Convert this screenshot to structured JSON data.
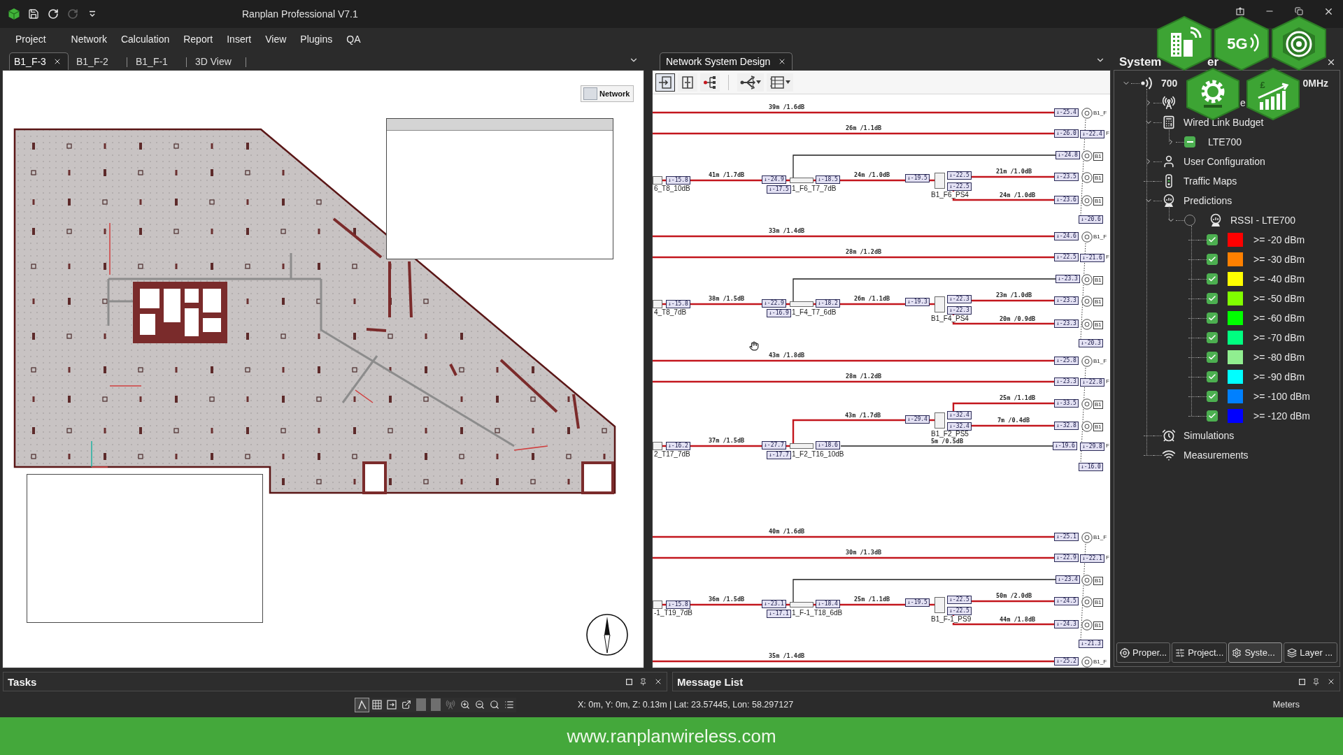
{
  "title_bar": {
    "quick_access": [
      {
        "kind": "save",
        "disabled": false
      },
      {
        "kind": "undo",
        "disabled": false
      },
      {
        "kind": "redo",
        "disabled": true
      },
      {
        "kind": "customize",
        "disabled": false
      }
    ],
    "title": "Ranplan Professional V7.1"
  },
  "overlay_badges": [
    {
      "kind": "building"
    },
    {
      "kind": "cellular",
      "label": "5G"
    },
    {
      "kind": "rings"
    },
    {
      "kind": "gear"
    },
    {
      "kind": "chart",
      "label": "£"
    }
  ],
  "menu": [
    {
      "label": "Project"
    },
    {
      "label": "Network"
    },
    {
      "label": "Calculation"
    },
    {
      "label": "Report"
    },
    {
      "label": "Insert"
    },
    {
      "label": "View"
    },
    {
      "label": "Plugins"
    },
    {
      "label": "QA"
    }
  ],
  "floor_tabs": [
    {
      "label": "B1_F-3",
      "selected": true
    },
    {
      "label": "B1_F-2",
      "selected": false
    },
    {
      "label": "B1_F-1",
      "selected": false
    },
    {
      "label": "3D View",
      "selected": false
    }
  ],
  "floor_plan": {
    "layer_button": "Network"
  },
  "design_tab": {
    "label": "Network System Design",
    "selected": true
  },
  "design_toolbar": [
    {
      "kind": "frame-arrow",
      "selected": true,
      "dropdown": false
    },
    {
      "kind": "frame-split",
      "selected": false,
      "dropdown": false
    },
    {
      "kind": "node-tree",
      "selected": false,
      "dropdown": false
    },
    {
      "kind": "branch-arrows",
      "selected": false,
      "dropdown": true
    },
    {
      "kind": "table-grid",
      "selected": false,
      "dropdown": true
    }
  ],
  "diagram": {
    "groups": [
      {
        "kind": "splitter_below",
        "feeders": [
          {
            "cable": "39m /1.6dB",
            "end_tag": "↓-25.4",
            "antenna": "B1_F"
          },
          {
            "cable": "26m /1.1dB",
            "end_tag": "↓-26.0",
            "antenna_tag": "↓-22.4",
            "antenna": "F"
          }
        ],
        "source": {
          "name": "6_T8_10dB",
          "tag": "↓-15.8"
        },
        "cable_in": "41m /1.7dB",
        "tap": {
          "name": "1_F6_T7_7dB",
          "in_tag": "↓-24.9",
          "out_tag": "↓-17.5",
          "through_tag": "↓-18.5"
        },
        "tap_branch": {
          "end_tag": "↓-24.8",
          "antenna": "B1"
        },
        "cable_mid": "24m /1.0dB",
        "splitter": {
          "name": "B1_F6_PS4",
          "in_tag": "↓-19.5",
          "out_tags": [
            "↓-22.5",
            "↓-22.5"
          ]
        },
        "branches": [
          {
            "cable": "21m /1.0dB",
            "end_tag": "↓-23.5",
            "antenna": "B1"
          },
          {
            "cable": "24m /1.0dB",
            "end_tag": "↓-23.6",
            "antenna": "B1"
          }
        ],
        "bottom_tag": "↓-20.6"
      },
      {
        "kind": "splitter_below",
        "feeders": [
          {
            "cable": "33m /1.4dB",
            "end_tag": "↓-24.6",
            "antenna": "B1_F"
          },
          {
            "cable": "28m /1.2dB",
            "end_tag": "↓-22.5",
            "antenna_tag": "↓-21.6",
            "antenna": "F"
          }
        ],
        "source": {
          "name": "4_T8_7dB",
          "tag": "↓-15.8"
        },
        "cable_in": "38m /1.5dB",
        "tap": {
          "name": "1_F4_T7_6dB",
          "in_tag": "↓-22.9",
          "out_tag": "↓-16.9",
          "through_tag": "↓-18.2"
        },
        "tap_branch": {
          "end_tag": "↓-23.3",
          "antenna": "B1"
        },
        "cable_mid": "26m /1.1dB",
        "splitter": {
          "name": "B1_F4_PS4",
          "in_tag": "↓-19.3",
          "out_tags": [
            "↓-22.3",
            "↓-22.3"
          ]
        },
        "branches": [
          {
            "cable": "23m /1.0dB",
            "end_tag": "↓-23.3",
            "antenna": "B1"
          },
          {
            "cable": "20m /0.9dB",
            "end_tag": "↓-23.3",
            "antenna": "B1"
          }
        ],
        "bottom_tag": "↓-20.3"
      },
      {
        "kind": "splitter_above",
        "feeders": [
          {
            "cable": "43m /1.8dB",
            "end_tag": "↓-25.8",
            "antenna": "B1_F"
          },
          {
            "cable": "28m /1.2dB",
            "end_tag": "↓-23.3",
            "antenna_tag": "↓-22.8",
            "antenna": "F"
          }
        ],
        "source": {
          "name": "2_T17_7dB",
          "tag": "↓-16.2"
        },
        "cable_in": "37m /1.5dB",
        "tap": {
          "name": "1_F2_T16_10dB",
          "in_tag": "↓-27.7",
          "out_tag": "↓-17.7",
          "through_tag": "↓-18.6"
        },
        "tap_branch": {
          "cable": "5m /0.5dB",
          "end_tag": "↓-19.6",
          "antenna_tag": "↓-29.8",
          "antenna": "F"
        },
        "cable_mid": "43m /1.7dB",
        "splitter": {
          "name": "B1_F2_PS5",
          "in_tag": "↓-29.4",
          "out_tags": [
            "↓-32.4",
            "↓-32.4"
          ]
        },
        "branches": [
          {
            "cable": "25m /1.1dB",
            "end_tag": "↓-33.5",
            "antenna": "B1"
          },
          {
            "cable": "7m /0.4dB",
            "end_tag": "↓-32.8",
            "antenna": "B1"
          }
        ],
        "bottom_tag": "↓-16.0"
      },
      {
        "kind": "splitter_below",
        "feeders": [
          {
            "cable": "40m /1.6dB",
            "end_tag": "↓-25.1",
            "antenna": "B1_F"
          },
          {
            "cable": "30m /1.3dB",
            "end_tag": "↓-22.9",
            "antenna_tag": "↓-22.1",
            "antenna": "F"
          }
        ],
        "source": {
          "name": "-1_T19_7dB",
          "tag": "↓-15.8"
        },
        "cable_in": "36m /1.5dB",
        "tap": {
          "name": "1_F-1_T18_6dB",
          "in_tag": "↓-23.1",
          "out_tag": "↓-17.1",
          "through_tag": "↓-18.4"
        },
        "tap_branch": {
          "end_tag": "↓-23.4",
          "antenna": "B1"
        },
        "cable_mid": "25m /1.1dB",
        "splitter": {
          "name": "B1_F-1_PS9",
          "in_tag": "↓-19.5",
          "out_tags": [
            "↓-22.5",
            "↓-22.5"
          ]
        },
        "branches": [
          {
            "cable": "50m /2.0dB",
            "end_tag": "↓-24.5",
            "antenna": "B1"
          },
          {
            "cable": "44m /1.8dB",
            "end_tag": "↓-24.3",
            "antenna": "B1"
          }
        ],
        "bottom_tag": "↓-21.3"
      },
      {
        "kind": "feeders_only",
        "feeders": [
          {
            "cable": "35m /1.4dB",
            "end_tag": "↓-25.2",
            "antenna": "B1_F"
          }
        ]
      }
    ]
  },
  "system_panel": {
    "title_head": "System",
    "title_tail": "er",
    "tree": [
      {
        "kind": "signal",
        "label_head": "700",
        "label_tail": "0MHz",
        "expanded": true,
        "children": [
          {
            "kind": "antenna",
            "label_tail": "e",
            "expanded": false
          },
          {
            "kind": "calculator",
            "label": "Wired Link Budget",
            "expanded": true,
            "children": [
              {
                "kind": "check",
                "label": "LTE700",
                "checked": true,
                "partial": true,
                "expanded": false
              }
            ]
          },
          {
            "kind": "user",
            "label": "User Configuration",
            "expanded": false
          },
          {
            "kind": "traffic",
            "label": "Traffic Maps"
          },
          {
            "kind": "prediction",
            "label": "Predictions",
            "expanded": true,
            "children": [
              {
                "kind": "radio",
                "label": "RSSI - LTE700",
                "selected": false,
                "expanded": true,
                "children": [
                  {
                    "kind": "legend",
                    "label": ">= -20 dBm",
                    "color": "#ff0000",
                    "checked": true
                  },
                  {
                    "kind": "legend",
                    "label": ">= -30 dBm",
                    "color": "#ff8000",
                    "checked": true
                  },
                  {
                    "kind": "legend",
                    "label": ">= -40 dBm",
                    "color": "#ffff00",
                    "checked": true
                  },
                  {
                    "kind": "legend",
                    "label": ">= -50 dBm",
                    "color": "#80ff00",
                    "checked": true
                  },
                  {
                    "kind": "legend",
                    "label": ">= -60 dBm",
                    "color": "#00ff00",
                    "checked": true
                  },
                  {
                    "kind": "legend",
                    "label": ">= -70 dBm",
                    "color": "#00ff80",
                    "checked": true
                  },
                  {
                    "kind": "legend",
                    "label": ">= -80 dBm",
                    "color": "#90ee90",
                    "checked": true
                  },
                  {
                    "kind": "legend",
                    "label": ">= -90 dBm",
                    "color": "#00ffff",
                    "checked": true
                  },
                  {
                    "kind": "legend",
                    "label": ">= -100 dBm",
                    "color": "#0080ff",
                    "checked": true
                  },
                  {
                    "kind": "legend",
                    "label": ">= -120 dBm",
                    "color": "#0000ff",
                    "checked": true
                  }
                ]
              }
            ]
          },
          {
            "kind": "stopwatch",
            "label": "Simulations"
          },
          {
            "kind": "wifi",
            "label": "Measurements"
          }
        ]
      }
    ],
    "bottom_tabs": [
      {
        "kind": "properties",
        "label": "Proper...",
        "selected": false
      },
      {
        "kind": "project",
        "label": "Project...",
        "selected": false
      },
      {
        "kind": "system",
        "label": "Syste...",
        "selected": true
      },
      {
        "kind": "layers",
        "label": "Layer ...",
        "selected": false
      }
    ]
  },
  "tasks_panel": {
    "title": "Tasks"
  },
  "message_panel": {
    "title": "Message List"
  },
  "status_bar": {
    "tools": [
      {
        "kind": "angle",
        "selected": true,
        "disabled": false
      },
      {
        "kind": "grid",
        "selected": false,
        "disabled": false
      },
      {
        "kind": "frame-arrow",
        "selected": false,
        "disabled": false
      },
      {
        "kind": "export",
        "selected": false,
        "disabled": false
      },
      {
        "kind": "block",
        "selected": false,
        "disabled": false
      },
      {
        "kind": "block",
        "selected": false,
        "disabled": false
      },
      {
        "kind": "antenna",
        "selected": false,
        "disabled": true
      },
      {
        "kind": "zoom-in",
        "selected": false,
        "disabled": false
      },
      {
        "kind": "zoom-out",
        "selected": false,
        "disabled": false
      },
      {
        "kind": "zoom-fit",
        "selected": false,
        "disabled": false
      },
      {
        "kind": "list",
        "selected": false,
        "disabled": false
      }
    ],
    "coordinates": "X: 0m, Y: 0m, Z: 0.13m | Lat: 23.57445, Lon: 58.297127",
    "units": "Meters"
  },
  "banner": {
    "url": "www.ranplanwireless.com"
  }
}
